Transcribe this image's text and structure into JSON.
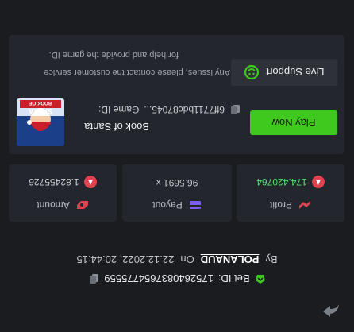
{
  "header": {
    "by_label": "By",
    "username": "POLANAUD",
    "on_label": "On",
    "datetime": "22.12.2022, 20:44:15",
    "bet_id_label": "Bet ID:",
    "bet_id": "1752640837654775559"
  },
  "stats": {
    "amount": {
      "label": "Amount",
      "value": "1.82455726"
    },
    "payout": {
      "label": "Payout",
      "value": "96.5691 x"
    },
    "profit": {
      "label": "Profit",
      "value": "174.420764"
    }
  },
  "game": {
    "name": "Book of Santa",
    "id_label": "Game ID:",
    "id_value": "6ff7711bdc87045...",
    "play_label": "Play Now",
    "thumb_title": "SANTA",
    "thumb_subtitle": "BOOK OF"
  },
  "support": {
    "help_line1": "Any issues, please contact the customer service",
    "help_line2": "for help and provide the game ID.",
    "live_label": "Live Support"
  },
  "colors": {
    "bg": "#1a1c20",
    "card": "#23262c",
    "accent_green": "#3fc91f",
    "profit_green": "#4ee06a",
    "coin_red": "#e0434f"
  }
}
